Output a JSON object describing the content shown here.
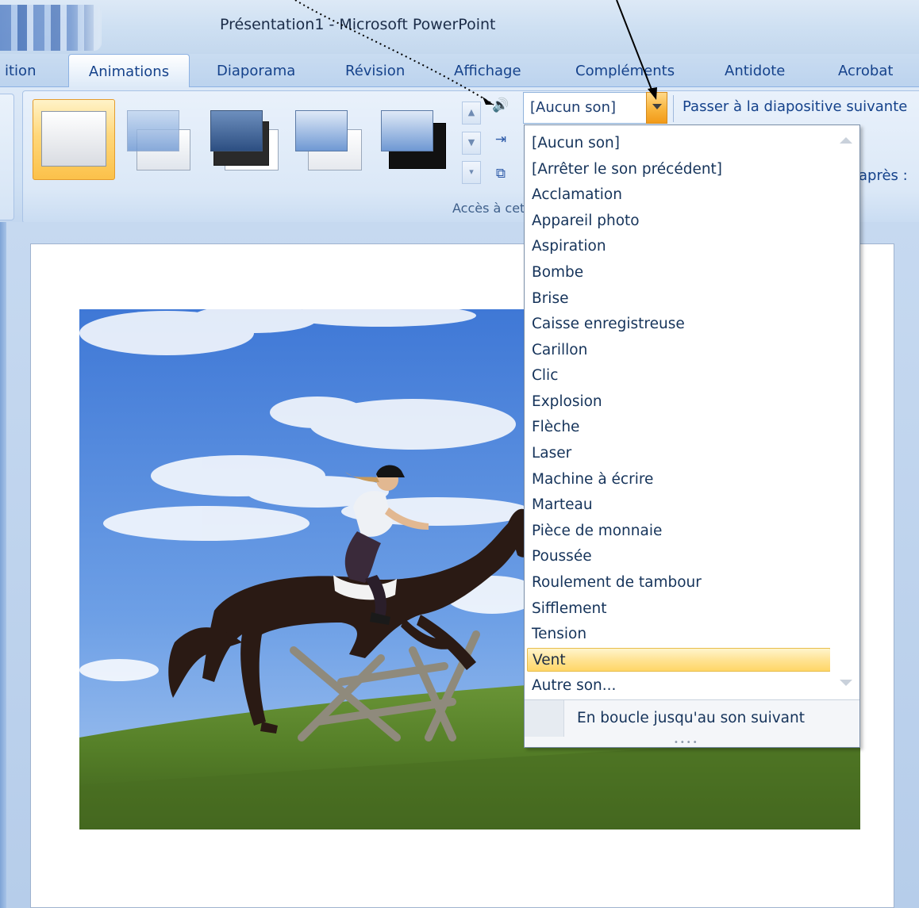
{
  "window": {
    "title": "Présentation1 - Microsoft PowerPoint"
  },
  "tabs": [
    {
      "label": "ition"
    },
    {
      "label": "Animations"
    },
    {
      "label": "Diaporama"
    },
    {
      "label": "Révision"
    },
    {
      "label": "Affichage"
    },
    {
      "label": "Compléments"
    },
    {
      "label": "Antidote"
    },
    {
      "label": "Acrobat"
    }
  ],
  "ribbon": {
    "group_label": "Accès à cett",
    "sound_value": "[Aucun son]",
    "advance_label": "Passer à la diapositive suivante",
    "after_label": "après :"
  },
  "dropdown": {
    "items": [
      "[Aucun son]",
      "[Arrêter le son précédent]",
      "Acclamation",
      "Appareil photo",
      "Aspiration",
      "Bombe",
      "Brise",
      "Caisse enregistreuse",
      "Carillon",
      "Clic",
      "Explosion",
      "Flèche",
      "Laser",
      "Machine à écrire",
      "Marteau",
      "Pièce de monnaie",
      "Poussée",
      "Roulement de tambour",
      "Sifflement",
      "Tension",
      "Vent",
      "Autre son..."
    ],
    "highlighted_item": "Vent",
    "footer_label": "En boucle jusqu'au son suivant"
  },
  "colors": {
    "highlight": "#ffd667",
    "accent": "#15428b"
  }
}
